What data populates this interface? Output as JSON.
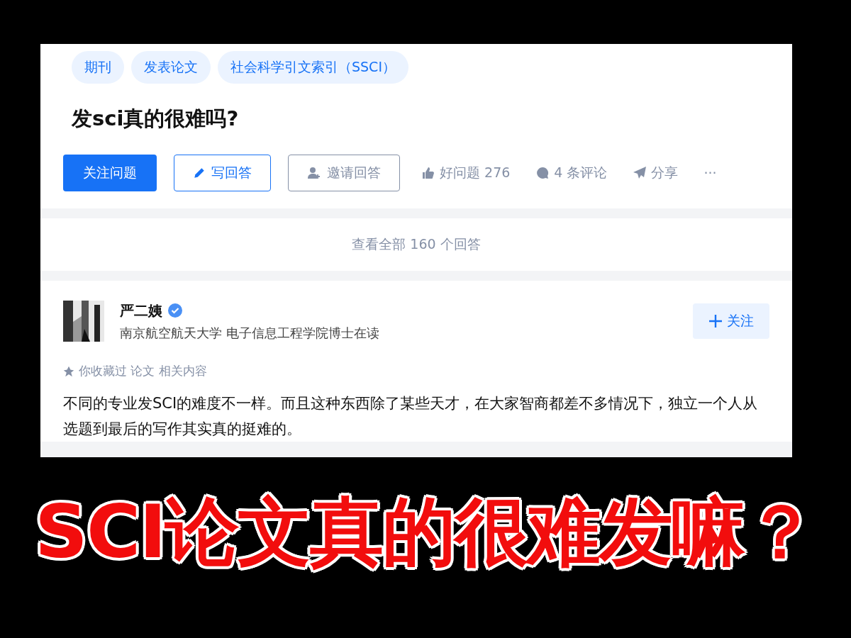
{
  "question": {
    "topics": [
      "期刊",
      "发表论文",
      "社会科学引文索引（SSCI）"
    ],
    "title": "发sci真的很难吗?",
    "actions": [
      {
        "kind": "primary",
        "label": "关注问题"
      },
      {
        "kind": "outline",
        "label": "写回答"
      },
      {
        "kind": "ghost",
        "label": "邀请回答"
      },
      {
        "kind": "plain",
        "label": "好问题 276"
      },
      {
        "kind": "plain",
        "label": "4 条评论"
      },
      {
        "kind": "plain",
        "label": "分享"
      },
      {
        "kind": "more",
        "label": "···"
      }
    ]
  },
  "view_all": "查看全部 160 个回答",
  "answer": {
    "author": "严二姨",
    "verified": true,
    "bio": "南京航空航天大学 电子信息工程学院博士在读",
    "follow": "关注",
    "collected": "你收藏过 论文 相关内容",
    "text": "不同的专业发SCI的难度不一样。而且这种东西除了某些天才，在大家智商都差不多情况下，独立一个人从选题到最后的写作其实真的挺难的。"
  },
  "caption": "SCI论文真的很难发嘛？"
}
